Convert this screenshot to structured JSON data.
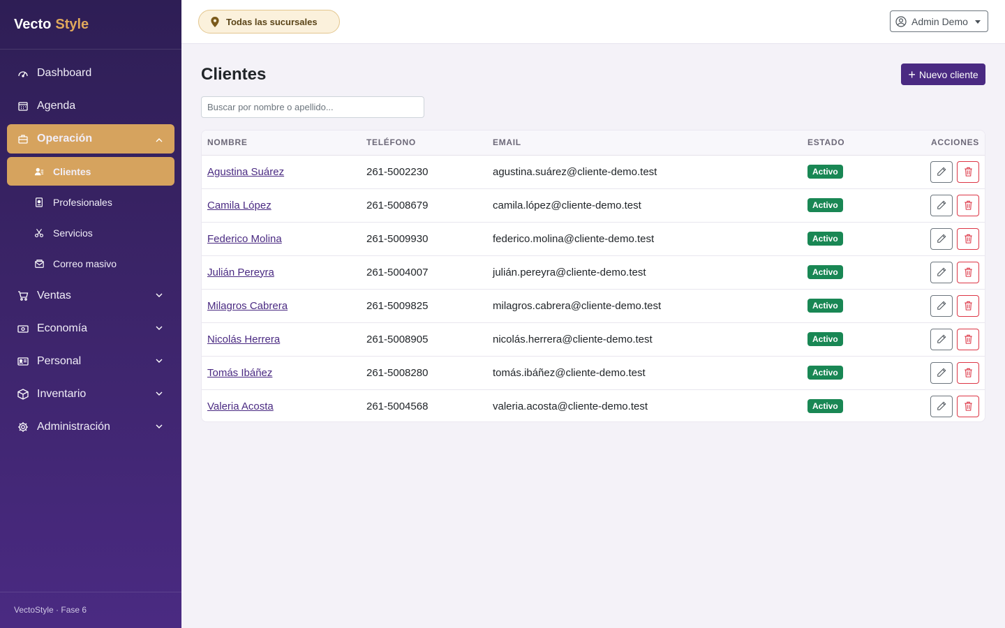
{
  "brand": {
    "part1": "Vecto",
    "part2": "Style"
  },
  "sidebar": {
    "items": [
      {
        "label": "Dashboard",
        "icon": "speedometer-icon"
      },
      {
        "label": "Agenda",
        "icon": "calendar-icon"
      },
      {
        "label": "Operación",
        "icon": "briefcase-icon",
        "expanded": true
      },
      {
        "label": "Ventas",
        "icon": "cart-icon"
      },
      {
        "label": "Economía",
        "icon": "cash-icon"
      },
      {
        "label": "Personal",
        "icon": "person-badge-icon"
      },
      {
        "label": "Inventario",
        "icon": "box-icon"
      },
      {
        "label": "Administración",
        "icon": "gear-icon"
      }
    ],
    "subitems": [
      {
        "label": "Clientes",
        "icon": "people-icon",
        "active": true
      },
      {
        "label": "Profesionales",
        "icon": "badge-icon"
      },
      {
        "label": "Servicios",
        "icon": "scissors-icon"
      },
      {
        "label": "Correo masivo",
        "icon": "envelope-icon"
      }
    ],
    "footer": "VectoStyle · Fase 6"
  },
  "topbar": {
    "branch": "Todas las sucursales",
    "user": "Admin Demo"
  },
  "page": {
    "title": "Clientes",
    "new_button": "Nuevo cliente",
    "search_placeholder": "Buscar por nombre o apellido..."
  },
  "table": {
    "headers": [
      "NOMBRE",
      "TELÉFONO",
      "EMAIL",
      "ESTADO",
      "ACCIONES"
    ],
    "rows": [
      {
        "name": "Agustina Suárez",
        "phone": "261-5002230",
        "email": "agustina.suárez@cliente-demo.test",
        "status": "Activo"
      },
      {
        "name": "Camila López",
        "phone": "261-5008679",
        "email": "camila.lópez@cliente-demo.test",
        "status": "Activo"
      },
      {
        "name": "Federico Molina",
        "phone": "261-5009930",
        "email": "federico.molina@cliente-demo.test",
        "status": "Activo"
      },
      {
        "name": "Julián Pereyra",
        "phone": "261-5004007",
        "email": "julián.pereyra@cliente-demo.test",
        "status": "Activo"
      },
      {
        "name": "Milagros Cabrera",
        "phone": "261-5009825",
        "email": "milagros.cabrera@cliente-demo.test",
        "status": "Activo"
      },
      {
        "name": "Nicolás Herrera",
        "phone": "261-5008905",
        "email": "nicolás.herrera@cliente-demo.test",
        "status": "Activo"
      },
      {
        "name": "Tomás Ibáñez",
        "phone": "261-5008280",
        "email": "tomás.ibáñez@cliente-demo.test",
        "status": "Activo"
      },
      {
        "name": "Valeria Acosta",
        "phone": "261-5004568",
        "email": "valeria.acosta@cliente-demo.test",
        "status": "Activo"
      }
    ]
  },
  "colors": {
    "sidebar": "#3b2468",
    "accent": "#d6a35e",
    "primary": "#4a2a82",
    "success": "#198754",
    "danger": "#dc3545"
  }
}
